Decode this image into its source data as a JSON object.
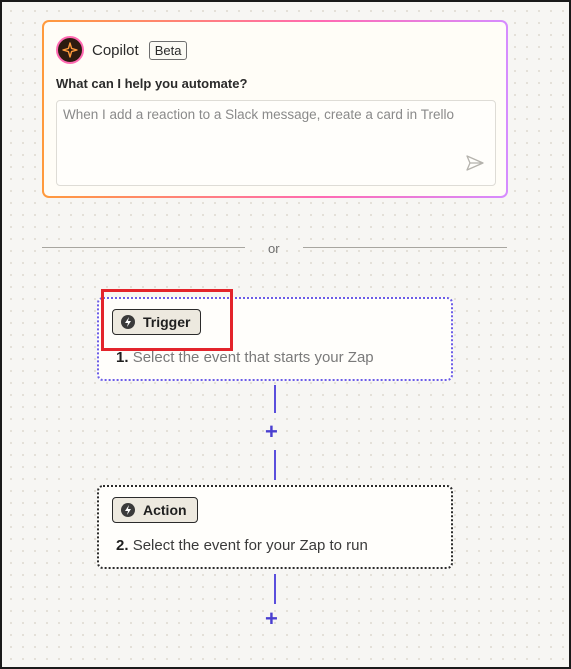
{
  "copilot": {
    "title": "Copilot",
    "badge": "Beta",
    "question": "What can I help you automate?",
    "prompt_placeholder": "When I add a reaction to a Slack message, create a card in Trello",
    "logo_icon": "sparkle-icon",
    "send_icon": "send-icon"
  },
  "divider": {
    "label": "or"
  },
  "trigger": {
    "chip_label": "Trigger",
    "number": "1.",
    "description": "Select the event that starts your Zap",
    "icon": "bolt-icon"
  },
  "action": {
    "chip_label": "Action",
    "number": "2.",
    "description": "Select the event for your Zap to run",
    "icon": "bolt-icon"
  },
  "connectors": {
    "add_symbol": "+"
  },
  "colors": {
    "accent": "#5b4fdc",
    "highlight": "#e3242b",
    "gradient_start": "#ff9a3c",
    "gradient_end": "#d68cff"
  }
}
